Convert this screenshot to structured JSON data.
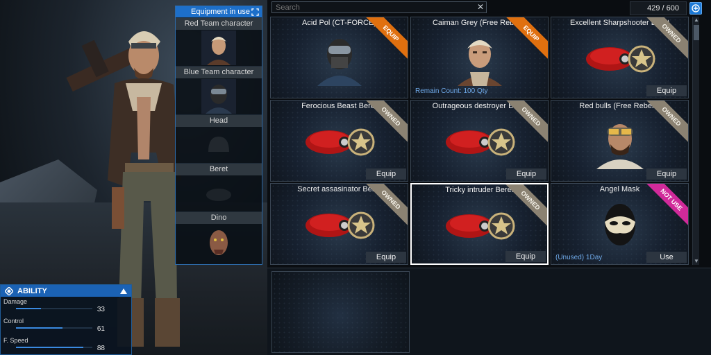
{
  "equipment_panel": {
    "title": "Equipment in use",
    "slots": [
      {
        "label": "Red Team character"
      },
      {
        "label": "Blue Team character"
      },
      {
        "label": "Head"
      },
      {
        "label": "Beret"
      },
      {
        "label": "Dino"
      }
    ]
  },
  "ability": {
    "title": "ABILITY",
    "stats": [
      {
        "name": "Damage",
        "value": "33",
        "level": 0.33
      },
      {
        "name": "Control",
        "value": "61",
        "level": 0.61
      },
      {
        "name": "F. Speed",
        "value": "88",
        "level": 0.88
      }
    ]
  },
  "inventory": {
    "search_placeholder": "Search",
    "count": "429 / 600",
    "items": [
      {
        "title": "Acid Pol (CT-FORCE)",
        "badge": "EQUIP",
        "badge_type": "equip",
        "icon": "masked-soldier-icon"
      },
      {
        "title": "Caiman Grey (Free Rebels)",
        "badge": "EQUIP",
        "badge_type": "equip",
        "note": "Remain Count: 100 Qty",
        "icon": "rebel-character-icon"
      },
      {
        "title": "Excellent Sharpshooter Beret",
        "badge": "OWNED",
        "badge_type": "owned",
        "button": "Equip",
        "icon": "red-beret-icon"
      },
      {
        "title": "Ferocious Beast Beret",
        "badge": "OWNED",
        "badge_type": "owned",
        "button": "Equip",
        "icon": "red-beret-icon"
      },
      {
        "title": "Outrageous destroyer Beret",
        "badge": "OWNED",
        "badge_type": "owned",
        "button": "Equip",
        "icon": "red-beret-icon"
      },
      {
        "title": "Red bulls (Free Rebels)",
        "badge": "OWNED",
        "badge_type": "owned",
        "button": "Equip",
        "icon": "bearded-soldier-icon"
      },
      {
        "title": "Secret assasinator Beret",
        "badge": "OWNED",
        "badge_type": "owned",
        "button": "Equip",
        "icon": "red-beret-icon"
      },
      {
        "title": "Tricky intruder Beret",
        "badge": "OWNED",
        "badge_type": "owned",
        "button": "Equip",
        "icon": "red-beret-icon",
        "selected": true
      },
      {
        "title": "Angel Mask",
        "badge": "NOT USE",
        "badge_type": "notuse",
        "button": "Use",
        "note": "(Unused) 1Day",
        "icon": "angel-mask-icon"
      }
    ]
  },
  "colors": {
    "accent": "#1d6fc9",
    "equip_badge": "#e0700f",
    "owned_badge": "#8b8272",
    "notuse_badge": "#d02a9a"
  }
}
